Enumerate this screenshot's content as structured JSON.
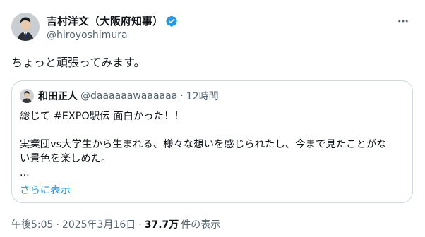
{
  "author": {
    "display_name": "吉村洋文（大阪府知事）",
    "handle": "@hiroyoshimura",
    "verified": true,
    "icons": {
      "verified": "verified-badge-icon",
      "more": "more-options-icon"
    },
    "accent_color": "#1d9bf0"
  },
  "tweet": {
    "text": "ちょっと頑張ってみます。"
  },
  "quote": {
    "display_name": "和田正人",
    "handle": "@daaaaaawaaaaaa",
    "separator": "·",
    "time": "12時間",
    "lines": [
      "総じて #EXPO駅伝 面白かった！！",
      "",
      "実業団vs大学生から生まれる、様々な想いを感じられたし、今まで見たことがな",
      "い景色を楽しめた。",
      "..."
    ],
    "show_more": "さらに表示"
  },
  "meta": {
    "time": "午後5:05",
    "separator": "·",
    "date": "2025年3月16日",
    "views_count": "37.7万",
    "views_label": "件の表示"
  }
}
